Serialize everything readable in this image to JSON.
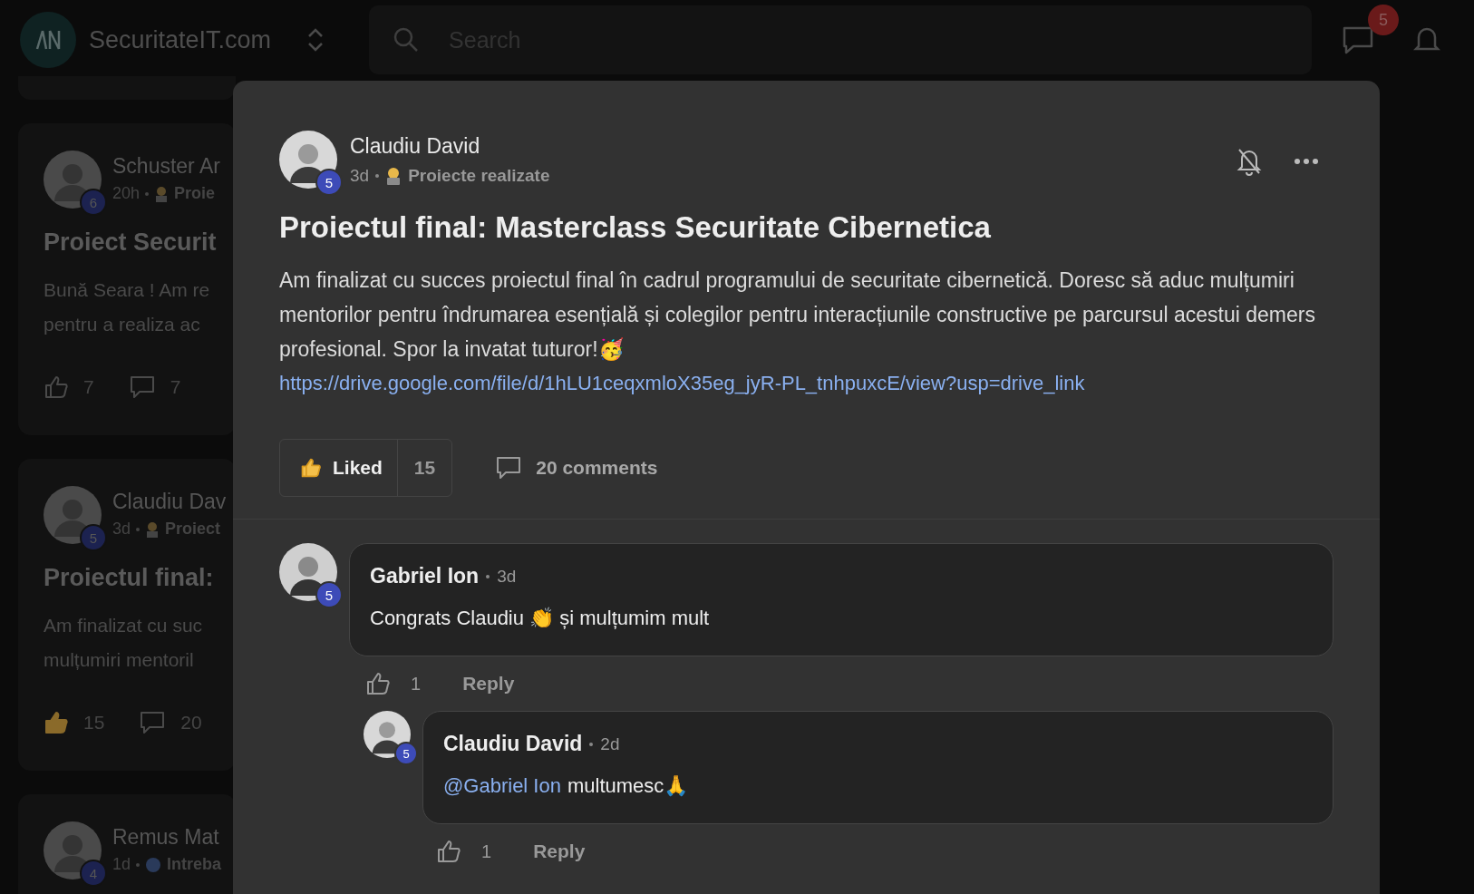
{
  "topbar": {
    "site_name": "SecuritateIT.com",
    "search": {
      "placeholder": "Search"
    },
    "chat_badge": "5"
  },
  "feed": [
    {
      "author": "Schuster Ar",
      "level_badge": "6",
      "time": "20h",
      "kind": "project",
      "category": "Proie",
      "title": "Proiect Securit",
      "body_lines": [
        "Bună Seara ! Am re",
        "pentru a realiza ac"
      ],
      "liked": false,
      "likes": "7",
      "comments": "7"
    },
    {
      "author": "Claudiu Dav",
      "level_badge": "5",
      "time": "3d",
      "kind": "project",
      "category": "Proiect",
      "title": "Proiectul final:",
      "body_lines": [
        "Am finalizat cu suc",
        "mulțumiri mentoril"
      ],
      "liked": true,
      "likes": "15",
      "comments": "20"
    },
    {
      "author": "Remus Mat",
      "level_badge": "4",
      "time": "1d",
      "kind": "question",
      "category": "Intreba"
    }
  ],
  "post": {
    "author": "Claudiu David",
    "level_badge": "5",
    "time": "3d",
    "category": "Proiecte realizate",
    "title": "Proiectul final: Masterclass Securitate Cibernetica",
    "body": "Am finalizat cu succes proiectul final în cadrul programului de securitate cibernetică. Doresc să aduc mulțumiri mentorilor pentru îndrumarea esențială și colegilor pentru interacțiunile constructive pe parcursul acestui demers profesional. Spor la invatat tuturor!🥳",
    "link": "https://drive.google.com/file/d/1hLU1ceqxmloX35eg_jyR-PL_tnhpuxcE/view?usp=drive_link",
    "liked": true,
    "like_label": "Liked",
    "like_count": "15",
    "comments_label": "20 comments"
  },
  "comments": [
    {
      "author": "Gabriel Ion",
      "level_badge": "5",
      "time": "3d",
      "text": "Congrats Claudiu 👏 și mulțumim mult",
      "likes": "1",
      "reply_label": "Reply",
      "children": [
        {
          "author": "Claudiu David",
          "level_badge": "5",
          "time": "2d",
          "mention": "@Gabriel Ion",
          "text": "multumesc🙏",
          "likes": "1",
          "reply_label": "Reply"
        }
      ]
    }
  ]
}
